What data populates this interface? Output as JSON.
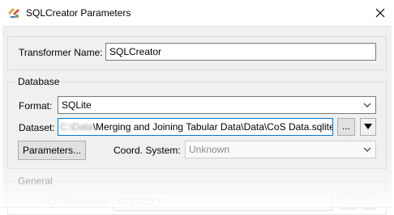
{
  "window": {
    "title": "SQLCreator Parameters",
    "icons": {
      "app": "sqlcreator-app-icon",
      "close": "close-icon"
    }
  },
  "transformer": {
    "label": "Transformer Name:",
    "value": "SQLCreator"
  },
  "database": {
    "group_label": "Database",
    "format_label": "Format:",
    "format_value": "SQLite",
    "dataset_label": "Dataset:",
    "dataset_value_hidden": "C:\\Data",
    "dataset_value": "\\Merging and Joining Tabular Data\\Data\\CoS Data.sqlite\"",
    "browse_label": "...",
    "parameters_label": "Parameters...",
    "coord_label": "Coord. System:",
    "coord_value": "Unknown"
  },
  "general": {
    "group_label": "General",
    "sql_label": "SQL Statement:",
    "sql_value": "SELECT *"
  },
  "colors": {
    "focus_border": "#0078d7",
    "dialog_bg": "#f0f0f0"
  }
}
